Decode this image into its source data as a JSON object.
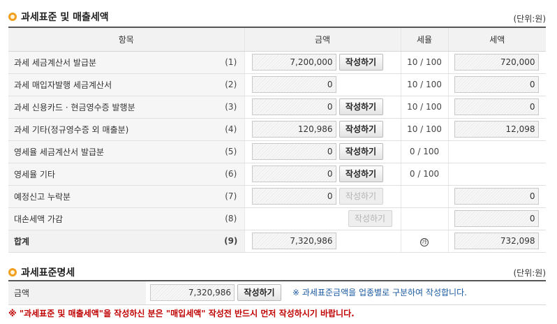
{
  "section1": {
    "title": "과세표준 및 매출세액",
    "unit": "(단위:원)",
    "headers": {
      "item": "항목",
      "amount": "금액",
      "rate": "세율",
      "tax": "세액"
    },
    "rows": [
      {
        "label": "과세 세금계산서 발급분",
        "no": "(1)",
        "amount": "7,200,000",
        "button": "작성하기",
        "rate": "10 / 100",
        "tax": "720,000"
      },
      {
        "label": "과세 매입자발행 세금계산서",
        "no": "(2)",
        "amount": "0",
        "rate": "10 / 100",
        "tax": "0"
      },
      {
        "label": "과세 신용카드 · 현금영수증 발행분",
        "no": "(3)",
        "amount": "0",
        "button": "작성하기",
        "rate": "10 / 100",
        "tax": "0"
      },
      {
        "label": "과세 기타(정규영수증 외 매출분)",
        "no": "(4)",
        "amount": "120,986",
        "button": "작성하기",
        "rate": "10 / 100",
        "tax": "12,098"
      },
      {
        "label": "영세율 세금계산서 발급분",
        "no": "(5)",
        "amount": "0",
        "button": "작성하기",
        "rate": "0 / 100"
      },
      {
        "label": "영세율 기타",
        "no": "(6)",
        "amount": "0",
        "button": "작성하기",
        "rate": "0 / 100"
      },
      {
        "label": "예정신고 누락분",
        "no": "(7)",
        "amount": "0",
        "button_disabled": "작성하기",
        "tax": "0"
      },
      {
        "label": "대손세액 가감",
        "no": "(8)",
        "button_disabled": "작성하기",
        "tax": "0"
      }
    ],
    "total": {
      "label": "합계",
      "no": "(9)",
      "amount": "7,320,986",
      "rate_symbol": "㉮",
      "tax": "732,098"
    }
  },
  "section2": {
    "title": "과세표준명세",
    "unit": "(단위:원)",
    "label": "금액",
    "amount": "7,320,986",
    "button": "작성하기",
    "note": "※ 과세표준금액을 업종별로 구분하여 작성합니다."
  },
  "warning": "※ \"과세표준 및 매출세액\"을 작성하신 분은 \"매입세액\" 작성전 반드시 먼저 작성하시기 바랍니다.",
  "colors": {
    "accent": "#f0a020",
    "note": "#1a5aa0",
    "warning": "#c00000"
  }
}
